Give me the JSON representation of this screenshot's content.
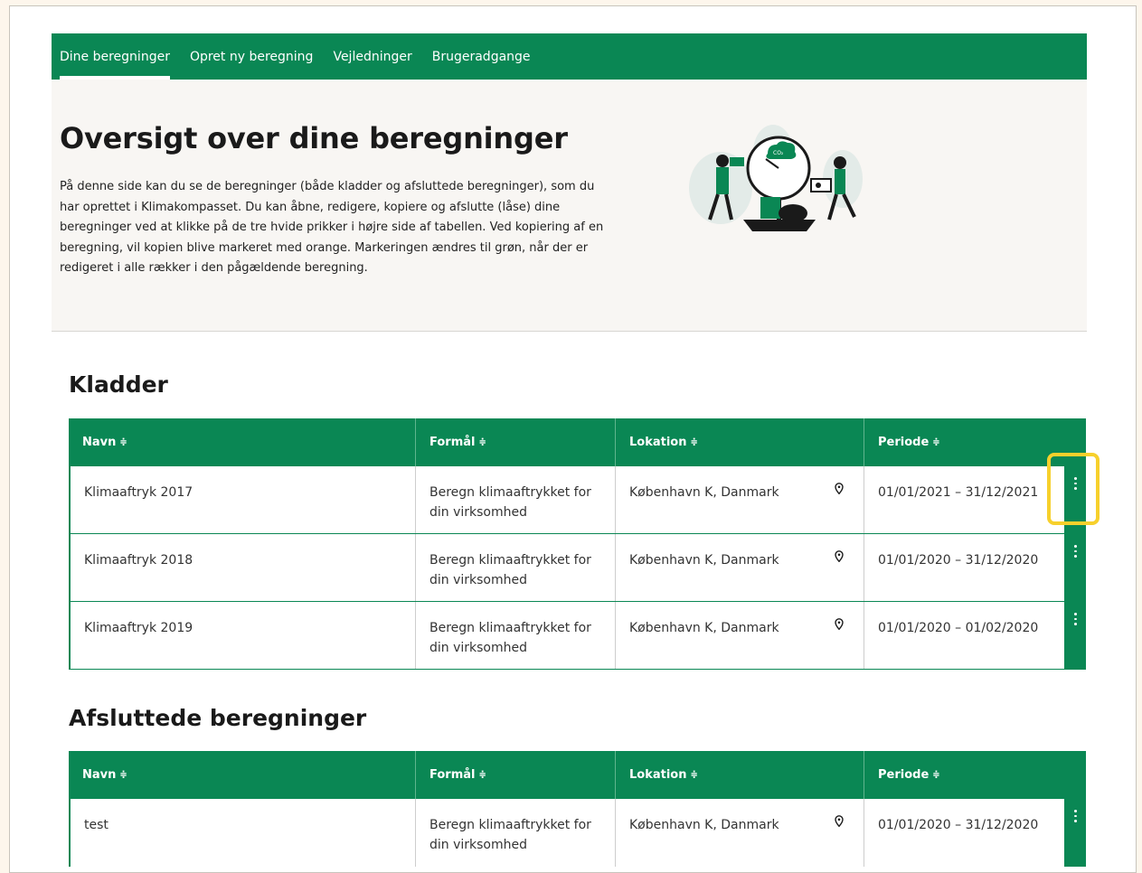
{
  "nav": {
    "items": [
      {
        "label": "Dine beregninger",
        "active": true
      },
      {
        "label": "Opret ny beregning",
        "active": false
      },
      {
        "label": "Vejledninger",
        "active": false
      },
      {
        "label": "Brugeradgange",
        "active": false
      }
    ]
  },
  "hero": {
    "title": "Oversigt over dine beregninger",
    "description": "På denne side kan du se de beregninger (både kladder og afsluttede beregninger), som du har oprettet i Klimakompasset. Du kan åbne, redigere, kopiere og afslutte (låse) dine beregninger ved at klikke på de tre hvide prikker i højre side af tabellen. Ved kopiering af en beregning, vil kopien blive markeret med orange. Markeringen ændres til grøn, når der er redigeret i alle rækker i den pågældende beregning.",
    "illustration_label": "CO₂"
  },
  "columns": [
    "Navn",
    "Formål",
    "Lokation",
    "Periode"
  ],
  "drafts": {
    "title": "Kladder",
    "rows": [
      {
        "name": "Klimaaftryk 2017",
        "purpose": "Beregn klimaaftrykket for din virksomhed",
        "location": "København K, Danmark",
        "period": "01/01/2021 – 31/12/2021"
      },
      {
        "name": "Klimaaftryk 2018",
        "purpose": "Beregn klimaaftrykket for din virksomhed",
        "location": "København K, Danmark",
        "period": "01/01/2020 – 31/12/2020"
      },
      {
        "name": "Klimaaftryk 2019",
        "purpose": "Beregn klimaaftrykket for din virksomhed",
        "location": "København K, Danmark",
        "period": "01/01/2020 – 01/02/2020"
      }
    ]
  },
  "finished": {
    "title": "Afsluttede beregninger",
    "rows": [
      {
        "name": "test",
        "purpose": "Beregn klimaaftrykket for din virksomhed",
        "location": "København K, Danmark",
        "period": "01/01/2020 – 31/12/2020"
      }
    ]
  },
  "colors": {
    "brand_green": "#0a8754",
    "highlight_yellow": "#f7d02c",
    "background": "#fdf6ec"
  }
}
